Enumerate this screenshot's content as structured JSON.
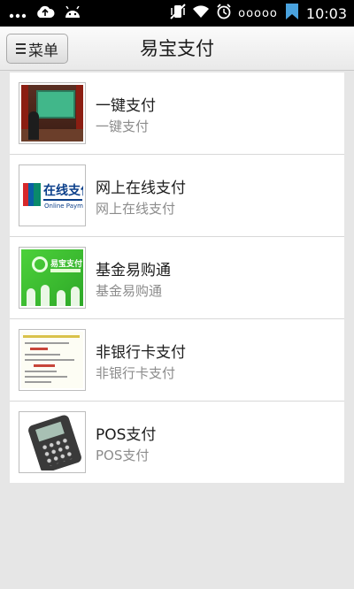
{
  "status_bar": {
    "time": "10:03",
    "dots": "ooooo",
    "icons": [
      "more-dots-icon",
      "cloud-upload-icon",
      "android-icon",
      "vibrate-icon",
      "wifi-icon",
      "alarm-icon",
      "bookmark-icon"
    ]
  },
  "header": {
    "menu_label": "菜单",
    "title": "易宝支付"
  },
  "list": {
    "items": [
      {
        "title": "一键支付",
        "subtitle": "一键支付",
        "thumb": "presentation-photo"
      },
      {
        "title": "网上在线支付",
        "subtitle": "网上在线支付",
        "thumb": "unionpay-online-payment-logo",
        "thumb_text": "在线支付",
        "thumb_sub": "Online Payment"
      },
      {
        "title": "基金易购通",
        "subtitle": "基金易购通",
        "thumb": "green-yeepay-banner",
        "thumb_text": "易宝支付"
      },
      {
        "title": "非银行卡支付",
        "subtitle": "非银行卡支付",
        "thumb": "webpage-screenshot"
      },
      {
        "title": "POS支付",
        "subtitle": "POS支付",
        "thumb": "pos-terminal-photo"
      }
    ]
  },
  "colors": {
    "status_bar_bg": "#000000",
    "page_bg": "#e6e6e6",
    "list_bg": "#ffffff",
    "subtitle_text": "#8c8c8c"
  }
}
